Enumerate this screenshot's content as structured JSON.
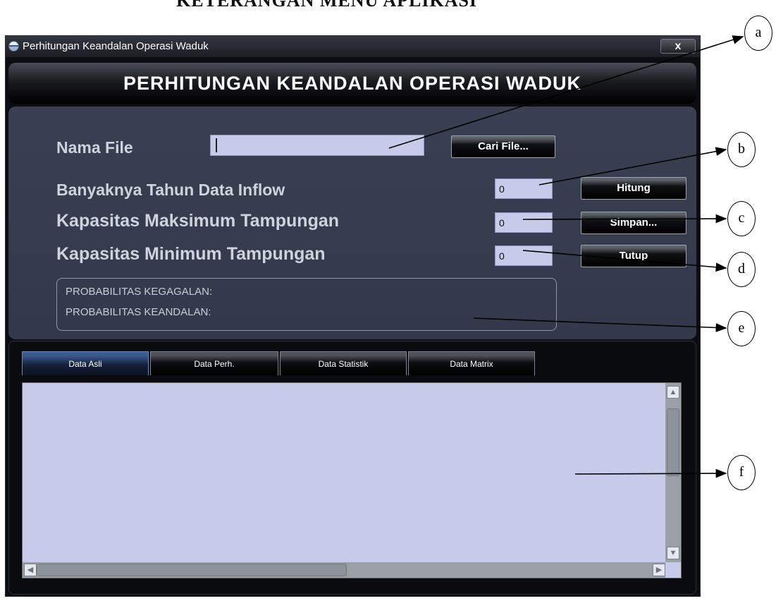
{
  "document_heading": "KETERANGAN MENU APLIKASI",
  "window": {
    "title": "Perhitungan Keandalan Operasi Waduk",
    "close_label": "x"
  },
  "banner_title": "PERHITUNGAN KEANDALAN OPERASI WADUK",
  "form": {
    "nama_file_label": "Nama File",
    "nama_file_value": "",
    "cari_file_button": "Cari File...",
    "banyaknya_tahun_label": "Banyaknya Tahun Data Inflow",
    "banyaknya_tahun_value": "0",
    "kapasitas_maks_label": "Kapasitas Maksimum Tampungan",
    "kapasitas_maks_value": "0",
    "kapasitas_min_label": "Kapasitas Minimum Tampungan",
    "kapasitas_min_value": "0",
    "hitung_button": "Hitung",
    "simpan_button": "Simpan...",
    "tutup_button": "Tutup"
  },
  "results": {
    "kegagalan_label": "PROBABILITAS KEGAGALAN:",
    "keandalan_label": "PROBABILITAS KEANDALAN:"
  },
  "tabs": [
    {
      "label": "Data Asli",
      "active": true
    },
    {
      "label": "Data Perh.",
      "active": false
    },
    {
      "label": "Data Statistik",
      "active": false
    },
    {
      "label": "Data Matrix",
      "active": false
    }
  ],
  "callouts": [
    "a",
    "b",
    "c",
    "d",
    "e",
    "f"
  ],
  "colors": {
    "window_bg": "#0b0d12",
    "panel_bg": "#3a3f52",
    "field_bg": "#c6cbe9",
    "label_text": "#cfd3de",
    "active_tab": "#3c5a92"
  },
  "icons": {
    "app": "globe-icon",
    "close": "close-icon",
    "scroll_up": "arrow-up-icon",
    "scroll_down": "arrow-down-icon",
    "scroll_left": "arrow-left-icon",
    "scroll_right": "arrow-right-icon"
  }
}
